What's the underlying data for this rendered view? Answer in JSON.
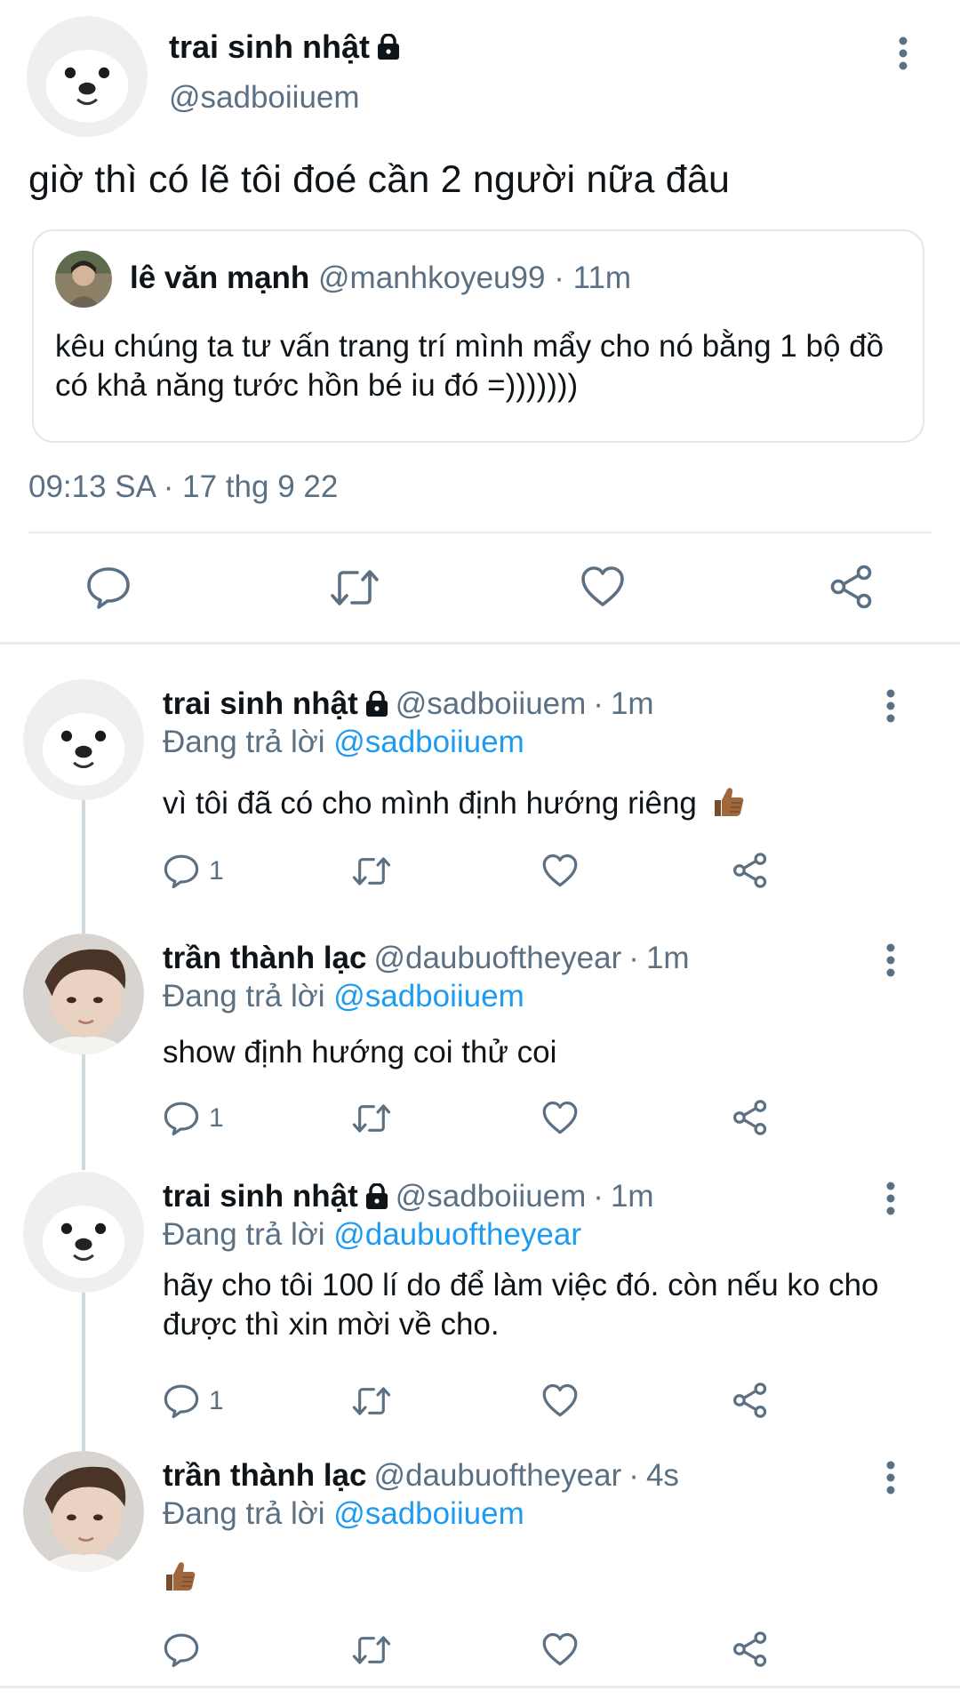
{
  "main_tweet": {
    "author_name": "trai sinh nhật",
    "author_handle": "@sadboiiuem",
    "text": "giờ thì có lẽ tôi đoé cần 2 người nữa đâu",
    "quote": {
      "author_name": "lê văn mạnh",
      "author_handle": "@manhkoyeu99",
      "separator": "·",
      "time": "11m",
      "text": "kêu chúng ta tư vấn trang trí mình mẩy cho nó bằng 1 bộ đồ có khả năng tước hồn bé iu đó =)))))))"
    },
    "timestamp": "09:13 SA · 17 thg 9 22"
  },
  "replies": [
    {
      "author_name": "trai sinh nhật",
      "protected": true,
      "author_handle": "@sadboiiuem",
      "separator": "·",
      "time": "1m",
      "replying_prefix": "Đang trả lời",
      "replying_to": "@sadboiiuem",
      "text": "vì tôi đã có cho mình định hướng riêng",
      "emoji": "thumbs-up",
      "reply_count": "1"
    },
    {
      "author_name": "trần thành lạc",
      "protected": false,
      "author_handle": "@daubuoftheyear",
      "separator": "·",
      "time": "1m",
      "replying_prefix": "Đang trả lời",
      "replying_to": "@sadboiiuem",
      "text": "show định hướng coi thử coi",
      "reply_count": "1"
    },
    {
      "author_name": "trai sinh nhật",
      "protected": true,
      "author_handle": "@sadboiiuem",
      "separator": "·",
      "time": "1m",
      "replying_prefix": "Đang trả lời",
      "replying_to": "@daubuoftheyear",
      "text": "hãy cho tôi 100 lí do để làm việc đó. còn nếu ko cho được thì xin mời về cho.",
      "reply_count": "1"
    },
    {
      "author_name": "trần thành lạc",
      "protected": false,
      "author_handle": "@daubuoftheyear",
      "separator": "·",
      "time": "4s",
      "replying_prefix": "Đang trả lời",
      "replying_to": "@sadboiiuem",
      "text": "",
      "emoji": "thumbs-up",
      "reply_count": ""
    }
  ],
  "icons": {
    "reply": "reply-icon",
    "retweet": "retweet-icon",
    "like": "like-icon",
    "share": "share-icon",
    "more": "more-icon",
    "lock": "lock-icon"
  },
  "colors": {
    "link": "#1d9bf0",
    "muted": "#5b7083",
    "separator": "#e6ecf0",
    "skin_tone_emoji": "#a0673c"
  }
}
